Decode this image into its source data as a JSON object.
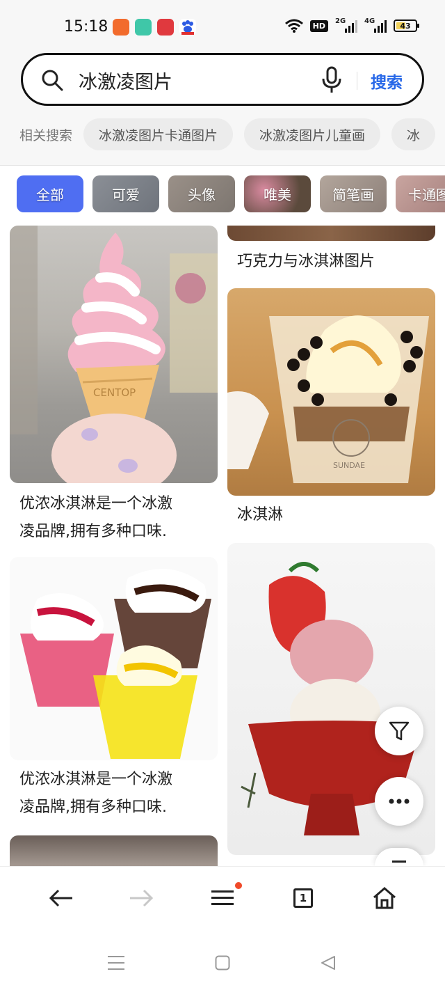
{
  "status_bar": {
    "time": "15:18",
    "network_hd": "HD",
    "signal_1_label": "2G",
    "signal_2_label": "4G",
    "battery_level": "43"
  },
  "search": {
    "query": "冰激凌图片",
    "button_label": "搜索"
  },
  "related": {
    "label": "相关搜索",
    "items": [
      "冰激凌图片卡通图片",
      "冰激凌图片儿童画",
      "冰"
    ]
  },
  "tags": [
    "全部",
    "可爱",
    "头像",
    "唯美",
    "简笔画",
    "卡通图"
  ],
  "results": {
    "left_col": [
      {
        "caption_line1": "优浓冰淇淋是一个冰激",
        "caption_line2": "凌品牌,拥有多种口味."
      },
      {
        "caption_line1": "优浓冰淇淋是一个冰激",
        "caption_line2": "凌品牌,拥有多种口味."
      }
    ],
    "right_col": [
      {
        "caption": "巧克力与冰淇淋图片"
      },
      {
        "caption": "冰淇淋"
      }
    ],
    "cone_text": "CENTOP",
    "cup_text": "SUNDAE"
  },
  "bottom_nav": {
    "tab_count": "1"
  },
  "colors": {
    "accent": "#2868e8",
    "tag_active": "#4f6ef2",
    "notification_dot": "#f04a2a"
  }
}
